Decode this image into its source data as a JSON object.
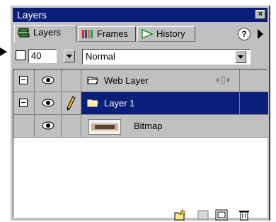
{
  "panel": {
    "title": "Layers",
    "close_label": "×",
    "help_label": "?"
  },
  "tabs": [
    {
      "label": "Layers"
    },
    {
      "label": "Frames"
    },
    {
      "label": "History"
    }
  ],
  "controls": {
    "opacity_value": "40",
    "blend_mode": "Normal"
  },
  "layers": [
    {
      "name": "Web Layer"
    },
    {
      "name": "Layer 1"
    },
    {
      "name": "Bitmap"
    }
  ],
  "thumb_text": "Bitmap",
  "colors": {
    "titlebar": "#0a1f7a",
    "selection": "#0a1f7a",
    "panel_bg": "#c0c0c0"
  }
}
